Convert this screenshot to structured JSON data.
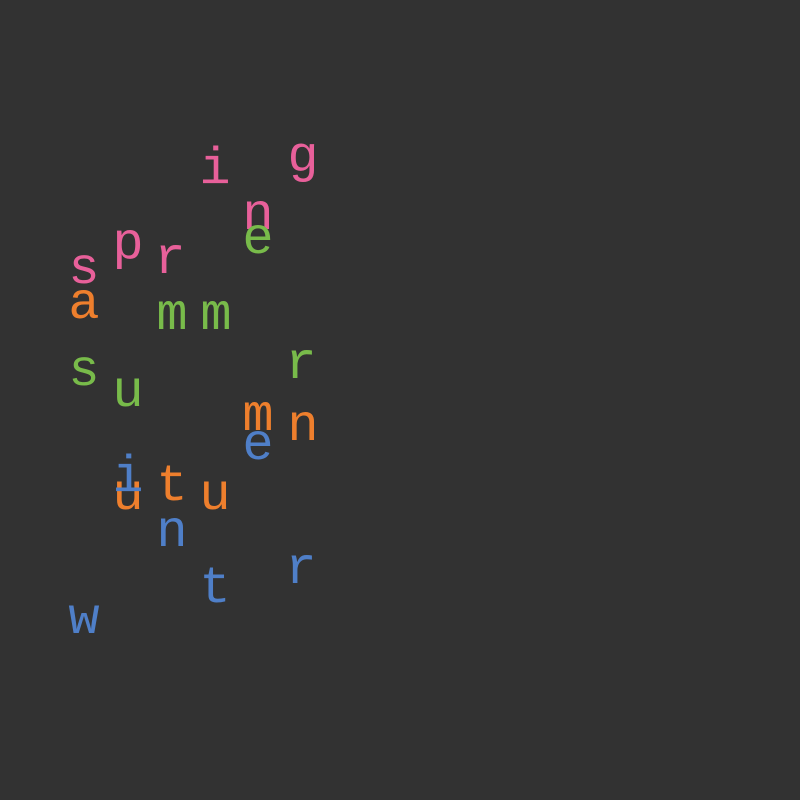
{
  "colors": {
    "background": "#323232",
    "pink": "#e8609a",
    "green": "#78bb4a",
    "orange": "#ee7f2d",
    "blue": "#4f7fc8"
  },
  "words": [
    {
      "word": "spring",
      "color": "#e8609a",
      "letters": [
        "s",
        "p",
        "r",
        "i",
        "n",
        "g"
      ]
    },
    {
      "word": "summer",
      "color": "#78bb4a",
      "letters": [
        "s",
        "u",
        "m",
        "m",
        "e",
        "r"
      ]
    },
    {
      "word": "autumn",
      "color": "#ee7f2d",
      "letters": [
        "a",
        "u",
        "t",
        "u",
        "m",
        "n"
      ]
    },
    {
      "word": "winter",
      "color": "#4f7fc8",
      "letters": [
        "w",
        "i",
        "n",
        "t",
        "e",
        "r"
      ]
    }
  ]
}
